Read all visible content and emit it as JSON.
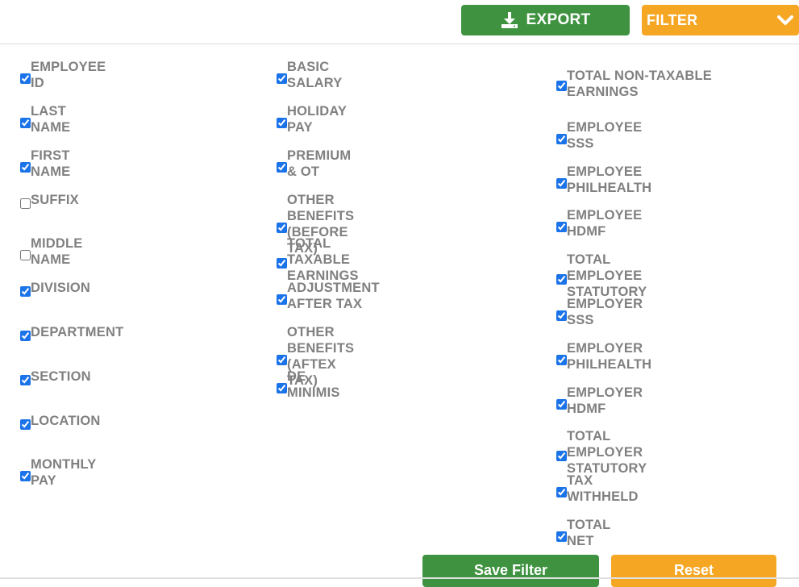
{
  "colors": {
    "green": "#3f9340",
    "orange": "#f5a623",
    "text": "#808080",
    "check": "#1a73e8"
  },
  "toolbar": {
    "export_label": "EXPORT",
    "filter_label": "FILTER",
    "export_icon": "download-icon",
    "filter_icon": "chevron-down-icon"
  },
  "columns": [
    {
      "items": [
        {
          "label": "EMPLOYEE ID",
          "checked": true
        },
        {
          "label": "LAST NAME",
          "checked": true
        },
        {
          "label": "FIRST NAME",
          "checked": true
        },
        {
          "label": "SUFFIX",
          "checked": false
        },
        {
          "label": "MIDDLE NAME",
          "checked": false
        },
        {
          "label": "DIVISION",
          "checked": true
        },
        {
          "label": "DEPARTMENT",
          "checked": true
        },
        {
          "label": "SECTION",
          "checked": true
        },
        {
          "label": "LOCATION",
          "checked": true
        },
        {
          "label": "MONTHLY PAY",
          "checked": true
        }
      ]
    },
    {
      "items": [
        {
          "label": "BASIC SALARY",
          "checked": true
        },
        {
          "label": "HOLIDAY PAY",
          "checked": true
        },
        {
          "label": "PREMIUM & OT",
          "checked": true
        },
        {
          "label": "OTHER BENEFITS (BEFORE TAX)",
          "checked": true
        },
        {
          "label": "TOTAL TAXABLE EARNINGS",
          "checked": true
        },
        {
          "label": "ADJUSTMENT AFTER TAX",
          "checked": true
        },
        {
          "label": "OTHER BENEFITS (AFTEX TAX)",
          "checked": true
        },
        {
          "label": "DE MINIMIS",
          "checked": true
        }
      ]
    },
    {
      "items": [
        {
          "label": "TOTAL NON-TAXABLE EARNINGS",
          "checked": true
        },
        {
          "label": "EMPLOYEE SSS",
          "checked": true
        },
        {
          "label": "EMPLOYEE PHILHEALTH",
          "checked": true
        },
        {
          "label": "EMPLOYEE HDMF",
          "checked": true
        },
        {
          "label": "TOTAL EMPLOYEE STATUTORY",
          "checked": true
        },
        {
          "label": "EMPLOYER SSS",
          "checked": true
        },
        {
          "label": "EMPLOYER PHILHEALTH",
          "checked": true
        },
        {
          "label": "EMPLOYER HDMF",
          "checked": true
        },
        {
          "label": "TOTAL EMPLOYER STATUTORY",
          "checked": true
        },
        {
          "label": "TAX WITHHELD",
          "checked": true
        },
        {
          "label": "TOTAL NET",
          "checked": true
        }
      ]
    }
  ],
  "footer": {
    "save_label": "Save Filter",
    "reset_label": "Reset"
  }
}
